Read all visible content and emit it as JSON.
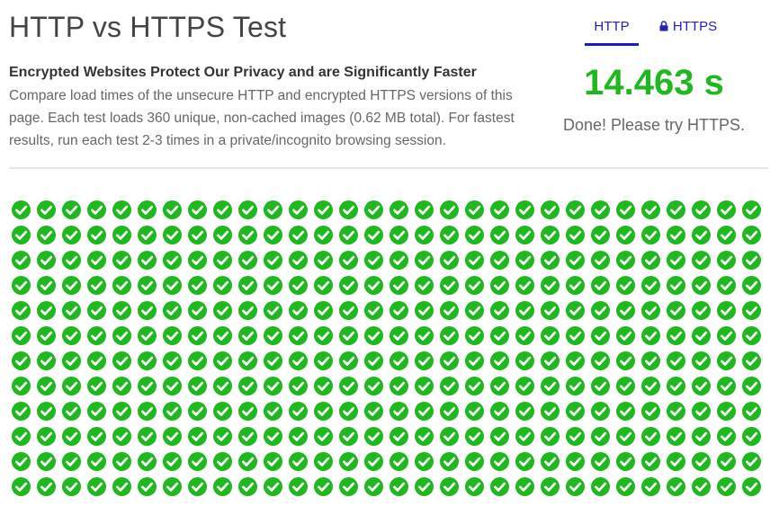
{
  "page": {
    "title": "HTTP vs HTTPS Test",
    "headline": "Encrypted Websites Protect Our Privacy and are Significantly Faster",
    "description": "Compare load times of the unsecure HTTP and encrypted HTTPS versions of this page. Each test loads 360 unique, non-cached images (0.62 MB total). For fastest results, run each test 2-3 times in a private/incognito browsing session."
  },
  "tabs": {
    "http": {
      "label": "HTTP",
      "active": true
    },
    "https": {
      "label": "HTTPS",
      "icon": "lock-icon",
      "active": false
    }
  },
  "result": {
    "time": "14.463 s",
    "status": "Done! Please try HTTPS."
  },
  "images": {
    "total": 360,
    "loaded": 360,
    "icon": "check-circle-icon"
  },
  "colors": {
    "success": "#1fb81f",
    "link": "#2222bb",
    "tab_underline": "#1a1acc"
  }
}
